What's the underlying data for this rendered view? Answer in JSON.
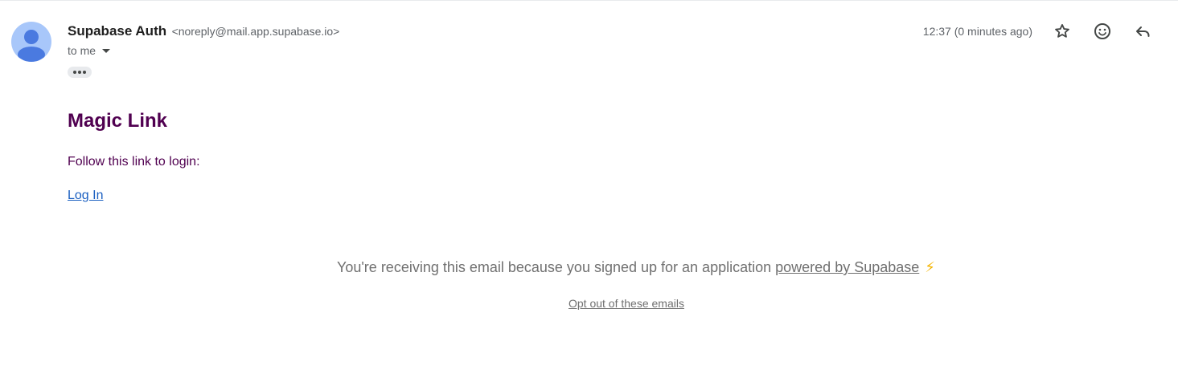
{
  "header": {
    "sender_name": "Supabase Auth",
    "sender_email": "<noreply@mail.app.supabase.io>",
    "recipient": "to me",
    "timestamp": "12:37 (0 minutes ago)",
    "icons": {
      "avatar": "person-avatar-icon",
      "caret": "chevron-down-icon",
      "ellipsis": "more-horizontal-icon",
      "star": "star-icon",
      "emoji": "emoji-reaction-icon",
      "reply": "reply-icon"
    }
  },
  "email": {
    "title": "Magic Link",
    "instruction": "Follow this link to login:",
    "login_link": "Log In",
    "footer_text": "You're receiving this email because you signed up for an application",
    "powered_link": "powered by Supabase",
    "bolt": "⚡",
    "optout_link": "Opt out of these emails"
  },
  "colors": {
    "title": "#500050",
    "link": "#1a5fc1",
    "footer": "#707070",
    "avatar_bg": "#a8c7fa",
    "avatar_fg": "#4a7ae0"
  }
}
